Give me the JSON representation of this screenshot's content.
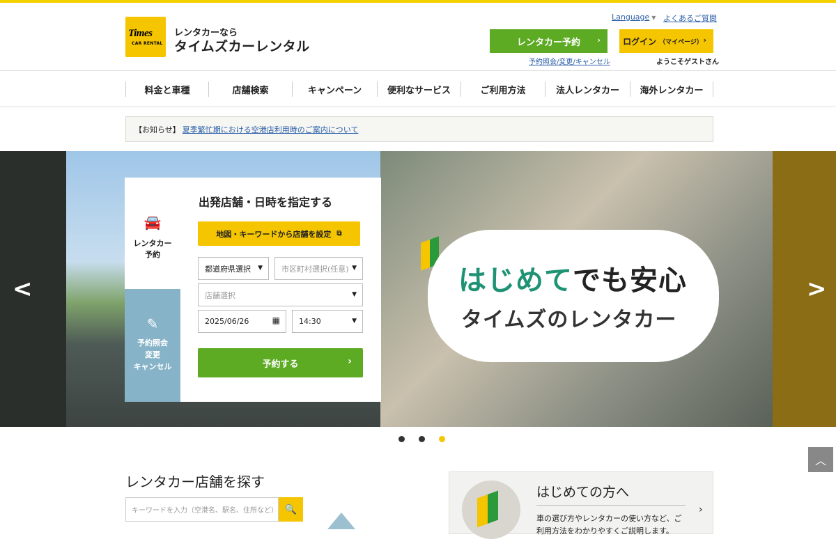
{
  "header": {
    "logo_text": "Times",
    "logo_sub": "CAR RENTAL",
    "brand_sub": "レンタカーなら",
    "brand_main": "タイムズカーレンタル",
    "language": "Language",
    "faq": "よくあるご質問",
    "reserve_button": "レンタカー予約",
    "login_button": "ログイン",
    "login_sub": "（マイページ）",
    "inquiry_link": "予約照会/変更/キャンセル",
    "welcome": "ようこそゲストさん"
  },
  "nav": [
    {
      "label": "料金と車種"
    },
    {
      "label": "店舗検索"
    },
    {
      "label": "キャンペーン"
    },
    {
      "label": "便利なサービス"
    },
    {
      "label": "ご利用方法"
    },
    {
      "label": "法人レンタカー"
    },
    {
      "label": "海外レンタカー"
    }
  ],
  "notice": {
    "tag": "【お知らせ】",
    "link": "夏季繁忙期における空港店利用時のご案内について"
  },
  "hero": {
    "bubble_line1_a": "はじめて",
    "bubble_line1_b": "でも安心",
    "bubble_line2": "タイムズのレンタカー"
  },
  "widget": {
    "tab_reserve": "レンタカー予約",
    "tab_inquiry_1": "予約照会",
    "tab_inquiry_2": "変更",
    "tab_inquiry_3": "キャンセル",
    "title": "出発店舗・日時を指定する",
    "map_button": "地図・キーワードから店舗を設定",
    "prefecture": "都道府県選択",
    "city": "市区町村選択(任意)",
    "store": "店舗選択",
    "date": "2025/06/26",
    "time": "14:30",
    "submit": "予約する"
  },
  "carousel": {
    "active": 3
  },
  "store_search": {
    "title": "レンタカー店舗を探す",
    "placeholder": "キーワードを入力（空港名、駅名、住所など）"
  },
  "guide": {
    "title": "はじめての方へ",
    "text": "車の選び方やレンタカーの使い方など、ご利用方法をわかりやすくご説明します。"
  }
}
